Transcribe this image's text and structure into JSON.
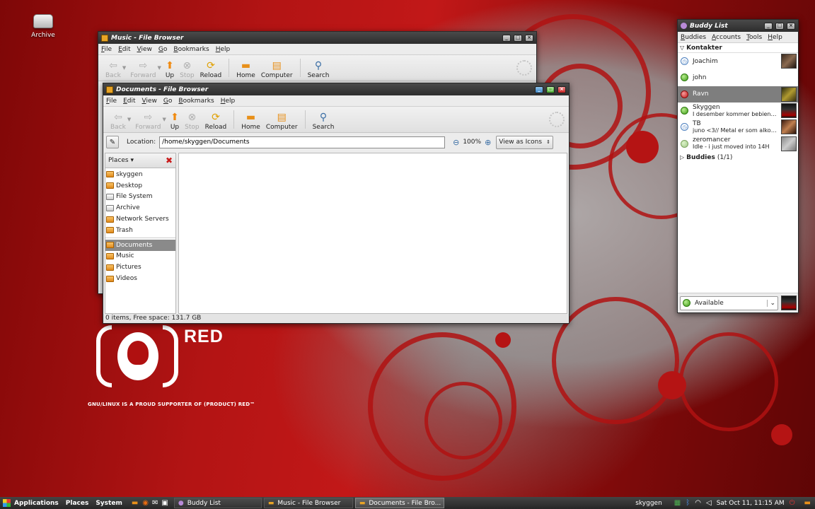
{
  "desktop": {
    "icon_archive": "Archive",
    "branding_red": "RED",
    "branding_tagline": "GNU/LINUX IS A PROUD SUPPORTER OF (PRODUCT) RED™"
  },
  "music_window": {
    "title": "Music - File Browser",
    "menu": [
      "File",
      "Edit",
      "View",
      "Go",
      "Bookmarks",
      "Help"
    ],
    "toolbar": {
      "back": "Back",
      "forward": "Forward",
      "up": "Up",
      "stop": "Stop",
      "reload": "Reload",
      "home": "Home",
      "computer": "Computer",
      "search": "Search"
    }
  },
  "docs_window": {
    "title": "Documents - File Browser",
    "menu": [
      "File",
      "Edit",
      "View",
      "Go",
      "Bookmarks",
      "Help"
    ],
    "toolbar": {
      "back": "Back",
      "forward": "Forward",
      "up": "Up",
      "stop": "Stop",
      "reload": "Reload",
      "home": "Home",
      "computer": "Computer",
      "search": "Search"
    },
    "location_label": "Location:",
    "location_value": "/home/skyggen/Documents",
    "zoom": "100%",
    "view_mode": "View as Icons",
    "places_label": "Places",
    "places": [
      "skyggen",
      "Desktop",
      "File System",
      "Archive",
      "Network Servers",
      "Trash"
    ],
    "bookmarks": [
      "Documents",
      "Music",
      "Pictures",
      "Videos"
    ],
    "status": "0 items, Free space: 131.7 GB"
  },
  "buddy_list": {
    "title": "Buddy List",
    "menu": [
      "Buddies",
      "Accounts",
      "Tools",
      "Help"
    ],
    "group1": "Kontakter",
    "buddies": [
      {
        "name": "Joachim",
        "message": "",
        "status": "away"
      },
      {
        "name": "john",
        "message": "",
        "status": "available"
      },
      {
        "name": "Ravn",
        "message": "",
        "status": "busy"
      },
      {
        "name": "Skyggen",
        "message": "I desember kommer bebien :D",
        "status": "available"
      },
      {
        "name": "TB",
        "message": "juno <3// Metal er som alkoh...",
        "status": "away"
      },
      {
        "name": "zeromancer",
        "message": "Idle - i just moved into 14H",
        "status": "idle"
      }
    ],
    "group2": "Buddies",
    "group2_count": "(1/1)",
    "status_select": "Available"
  },
  "panel": {
    "applications": "Applications",
    "places": "Places",
    "system": "System",
    "tasks": [
      "Buddy List",
      "Music - File Browser",
      "Documents - File Bro..."
    ],
    "user": "skyggen",
    "clock": "Sat Oct 11, 11:15 AM"
  },
  "colors": {
    "accent_red": "#c21818",
    "selection_gray": "#8a8a8a"
  }
}
